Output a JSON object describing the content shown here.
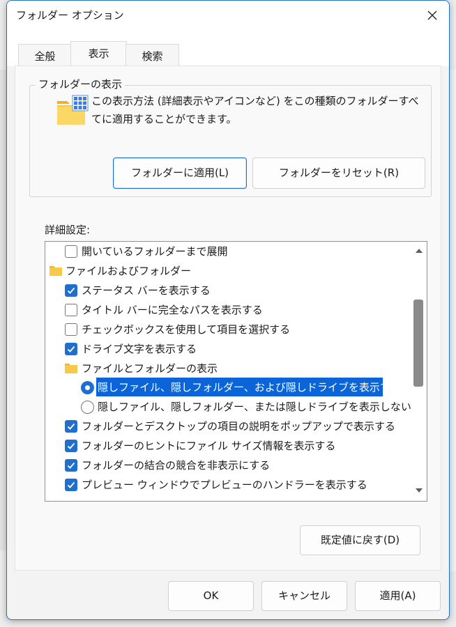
{
  "window": {
    "title": "フォルダー オプション",
    "close_icon": "close-icon"
  },
  "tabs": [
    {
      "label": "全般",
      "active": false
    },
    {
      "label": "表示",
      "active": true
    },
    {
      "label": "検索",
      "active": false
    }
  ],
  "folder_view": {
    "legend": "フォルダーの表示",
    "description_line1": "この表示方法 (詳細表示やアイコンなど) をこの種類のフォルダーすべ",
    "description_line2": "てに適用することができます。",
    "apply_button": "フォルダーに適用(L)",
    "reset_button": "フォルダーをリセット(R)"
  },
  "advanced": {
    "label": "詳細設定:",
    "items": [
      {
        "type": "checkbox",
        "label": "開いているフォルダーまで展開",
        "checked": false
      },
      {
        "type": "folder",
        "label": "ファイルおよびフォルダー"
      },
      {
        "type": "checkbox",
        "label": "ステータス バーを表示する",
        "checked": true
      },
      {
        "type": "checkbox",
        "label": "タイトル バーに完全なパスを表示する",
        "checked": false
      },
      {
        "type": "checkbox",
        "label": "チェックボックスを使用して項目を選択する",
        "checked": false
      },
      {
        "type": "checkbox",
        "label": "ドライブ文字を表示する",
        "checked": true
      },
      {
        "type": "folder",
        "label": "ファイルとフォルダーの表示"
      },
      {
        "type": "radio",
        "label": "隠しファイル、隠しフォルダー、および隠しドライブを表示する",
        "checked": true,
        "selected": true
      },
      {
        "type": "radio",
        "label": "隠しファイル、隠しフォルダー、または隠しドライブを表示しない",
        "checked": false
      },
      {
        "type": "checkbox",
        "label": "フォルダーとデスクトップの項目の説明をポップアップで表示する",
        "checked": true
      },
      {
        "type": "checkbox",
        "label": "フォルダーのヒントにファイル サイズ情報を表示する",
        "checked": true
      },
      {
        "type": "checkbox",
        "label": "フォルダーの結合の競合を非表示にする",
        "checked": true
      },
      {
        "type": "checkbox",
        "label": "プレビュー ウィンドウでプレビューのハンドラーを表示する",
        "checked": true
      }
    ]
  },
  "restore_button": "既定値に戻す(D)",
  "footer": {
    "ok": "OK",
    "cancel": "キャンセル",
    "apply": "適用(A)"
  },
  "colors": {
    "accent": "#1f6fcf",
    "selection": "#0b65d8"
  }
}
